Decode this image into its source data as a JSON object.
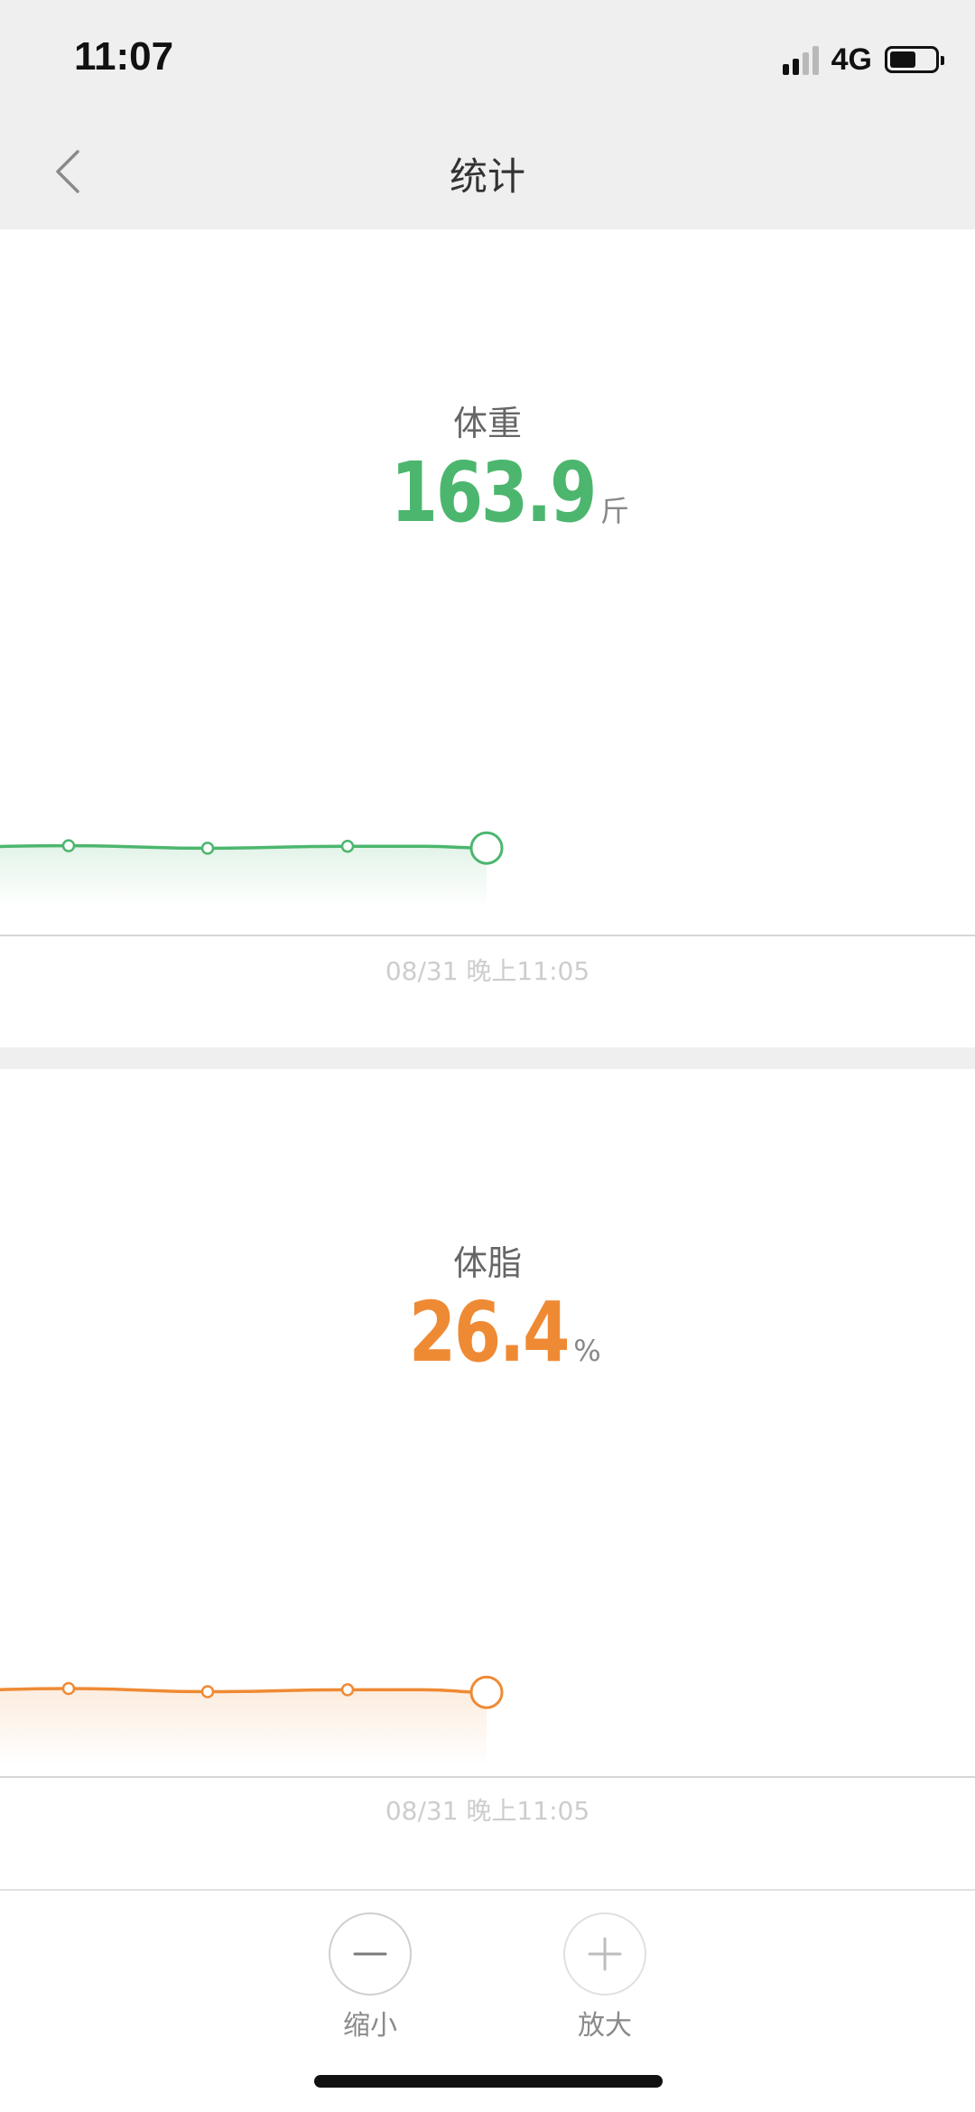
{
  "status_bar": {
    "time": "11:07",
    "network": "4G"
  },
  "nav": {
    "title": "统计",
    "back_icon": "chevron-left-icon"
  },
  "colors": {
    "weight": "#4cb66e",
    "body_fat": "#ef8a34",
    "axis": "#d6d6d6",
    "label": "#cdcdcd"
  },
  "weight": {
    "label": "体重",
    "value": "163.9",
    "unit": "斤",
    "time_label": "08/31 晚上11:05"
  },
  "body_fat": {
    "label": "体脂",
    "value": "26.4",
    "unit": "%",
    "time_label": "08/31 晚上11:05"
  },
  "chart_data": [
    {
      "type": "area",
      "series": [
        {
          "values": [
            164.5,
            165.2,
            163.8,
            164.9,
            164.9,
            163.9
          ]
        }
      ],
      "ylim": [
        150,
        175
      ],
      "grid": false
    },
    {
      "type": "area",
      "series": [
        {
          "values": [
            26.7,
            27.0,
            26.5,
            26.8,
            26.8,
            26.4
          ]
        }
      ],
      "ylim": [
        20,
        30
      ],
      "grid": false
    }
  ],
  "controls": {
    "zoom_out_label": "缩小",
    "zoom_in_label": "放大"
  }
}
